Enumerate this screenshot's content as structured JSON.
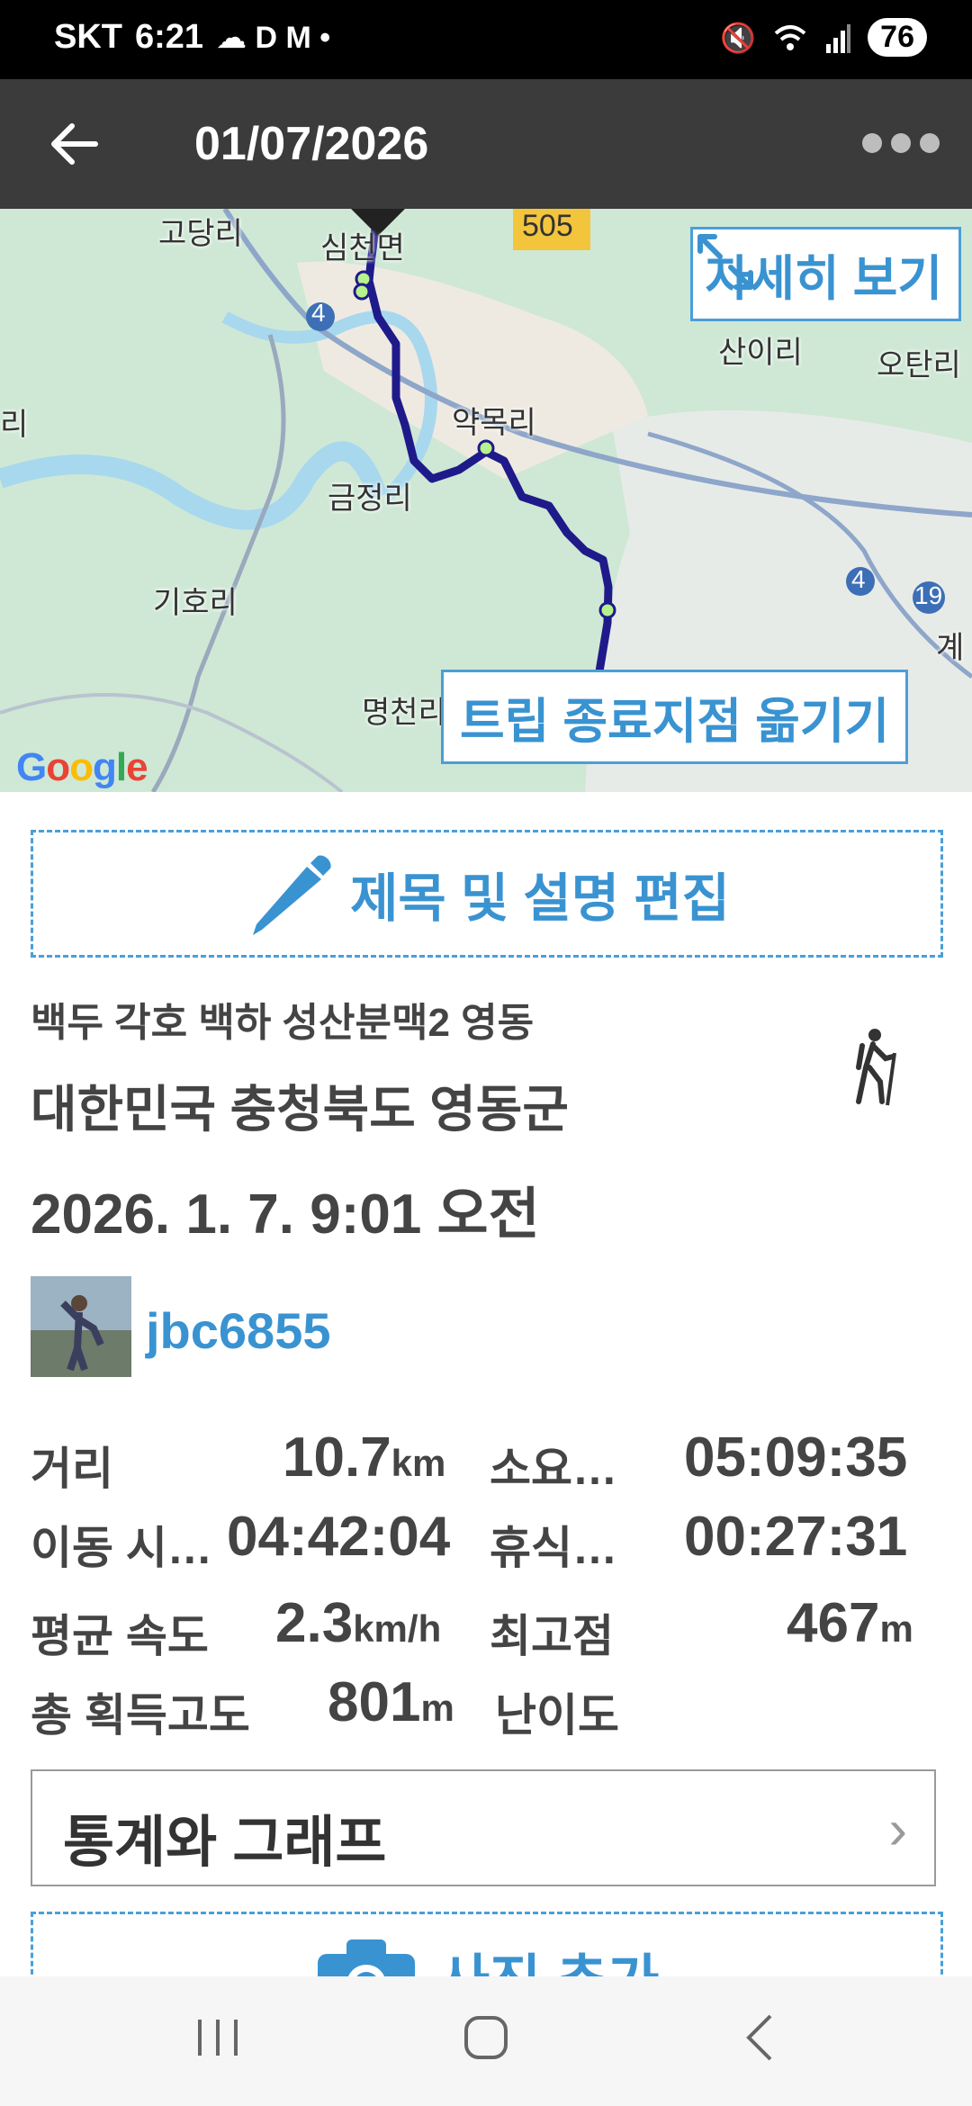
{
  "status_bar": {
    "carrier": "SKT",
    "time": "6:21",
    "battery": "76"
  },
  "app_bar": {
    "title": "01/07/2026"
  },
  "map": {
    "labels": {
      "godangri": "고당리",
      "simcheonmyeon": "심천면",
      "road505": "505",
      "sanyiri": "산이리",
      "otanri": "오탄리",
      "yakmokri": "약목리",
      "geumjeongri": "금정리",
      "gihori": "기호리",
      "myeongcheon": "명천리",
      "road4a": "4",
      "road4b": "4",
      "road19": "19",
      "gye": "계",
      "ri": "리"
    },
    "detail_button": "자세히 보기",
    "endpoint_button": "트립 종료지점 옮기기",
    "brand": "Google"
  },
  "edit": {
    "label": "제목 및 설명 편집"
  },
  "trip": {
    "title": "백두 각호 백하 성산분맥2 영동",
    "region": "대한민국 충청북도 영동군",
    "datetime": "2026. 1. 7. 9:01 오전"
  },
  "user": {
    "name": "jbc6855"
  },
  "stats": {
    "distance_label": "거리",
    "distance_value": "10.7",
    "distance_unit": "km",
    "duration_label": "소요…",
    "duration_value": "05:09:35",
    "moving_label": "이동 시…",
    "moving_value": "04:42:04",
    "rest_label": "휴식…",
    "rest_value": "00:27:31",
    "avg_speed_label": "평균 속도",
    "avg_speed_value": "2.3",
    "avg_speed_unit": "km/h",
    "max_alt_label": "최고점",
    "max_alt_value": "467",
    "max_alt_unit": "m",
    "gain_label": "총 획득고도",
    "gain_value": "801",
    "gain_unit": "m",
    "difficulty_label": "난이도"
  },
  "stats_button": {
    "label": "통계와 그래프"
  },
  "photo": {
    "label": "사진 추가"
  }
}
